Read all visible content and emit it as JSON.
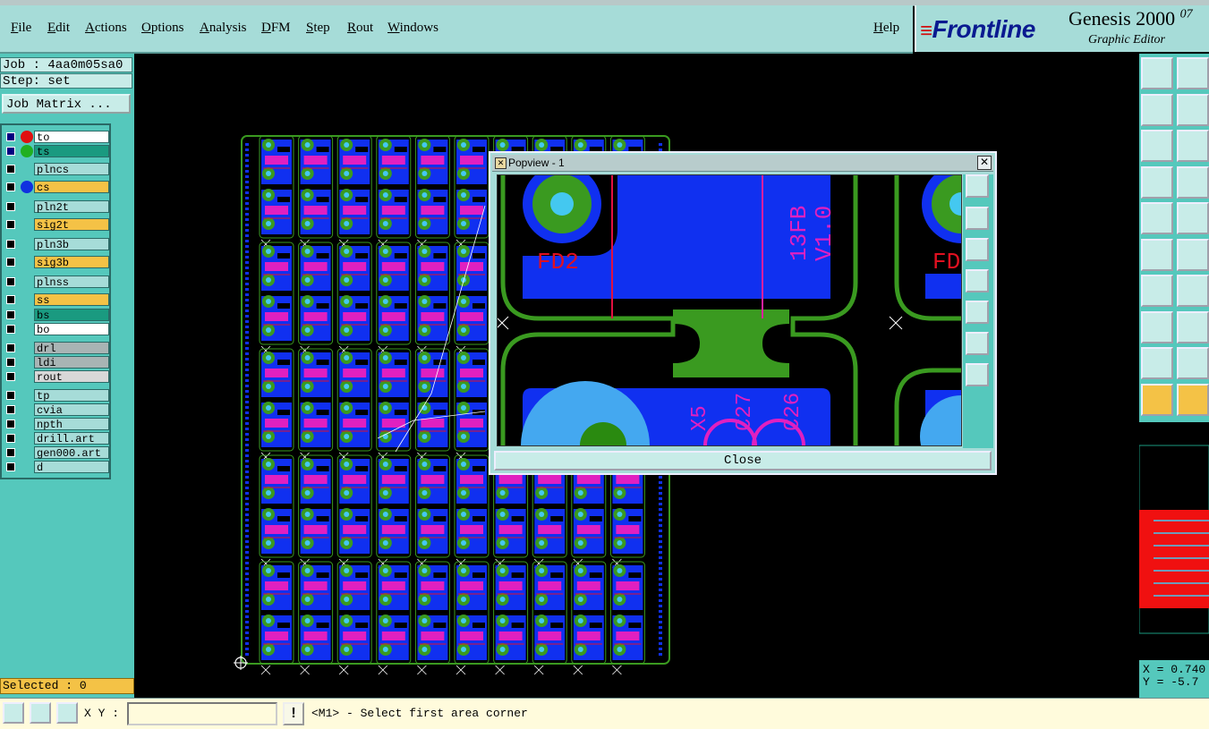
{
  "menu": {
    "items": [
      {
        "label": "File"
      },
      {
        "label": "Edit"
      },
      {
        "label": "Actions"
      },
      {
        "label": "Options"
      },
      {
        "label": "Analysis"
      },
      {
        "label": "DFM"
      },
      {
        "label": "Step"
      },
      {
        "label": "Rout"
      },
      {
        "label": "Windows"
      }
    ],
    "help": "Help"
  },
  "brand": {
    "logo": "Frontline",
    "product": "Genesis 2000",
    "version_fragment": "07",
    "subtitle": "Graphic Editor"
  },
  "job": {
    "job_line": "Job : 4aa0m05sa0",
    "step_line": "Step: set",
    "matrix_button": "Job Matrix ..."
  },
  "layers": [
    {
      "name": "to",
      "color": "#ffffff",
      "dot": "#e01010",
      "box": "#000080"
    },
    {
      "name": "ts",
      "color": "#1a9a80",
      "dot": "#20b020",
      "box": "#000080"
    },
    {
      "name": "plncs",
      "color": "#a6dcd8",
      "dot": "",
      "box": "#000000"
    },
    {
      "name": "cs",
      "color": "#f4c246",
      "dot": "#1030e0",
      "box": "#000000"
    },
    {
      "name": "pln2t",
      "color": "#a6dcd8",
      "dot": "",
      "box": "#000000"
    },
    {
      "name": "sig2t",
      "color": "#f4c246",
      "dot": "",
      "box": "#000000"
    },
    {
      "name": "pln3b",
      "color": "#a6dcd8",
      "dot": "",
      "box": "#000000"
    },
    {
      "name": "sig3b",
      "color": "#f4c246",
      "dot": "",
      "box": "#000000"
    },
    {
      "name": "plnss",
      "color": "#a6dcd8",
      "dot": "",
      "box": "#000000"
    },
    {
      "name": "ss",
      "color": "#f4c246",
      "dot": "",
      "box": "#000000"
    },
    {
      "name": "bs",
      "color": "#1a9a80",
      "dot": "",
      "box": "#000000"
    },
    {
      "name": "bo",
      "color": "#ffffff",
      "dot": "",
      "box": "#000000"
    },
    {
      "name": "drl",
      "color": "#a8b4b4",
      "dot": "",
      "box": "#000000"
    },
    {
      "name": "ldi",
      "color": "#a8b4b4",
      "dot": "",
      "box": "#000000"
    },
    {
      "name": "rout",
      "color": "#d8d8d8",
      "dot": "",
      "box": "#000000"
    },
    {
      "name": "tp",
      "color": "#a6dcd8",
      "dot": "",
      "box": "#000000"
    },
    {
      "name": "cvia",
      "color": "#a6dcd8",
      "dot": "",
      "box": "#000000"
    },
    {
      "name": "npth",
      "color": "#a6dcd8",
      "dot": "",
      "box": "#000000"
    },
    {
      "name": "drill.art",
      "color": "#a6dcd8",
      "dot": "",
      "box": "#000000"
    },
    {
      "name": "gen000.art",
      "color": "#a6dcd8",
      "dot": "",
      "box": "#000000"
    },
    {
      "name": "d",
      "color": "#a6dcd8",
      "dot": "",
      "box": "#000000"
    }
  ],
  "selected": "Selected : 0",
  "popup": {
    "title": "Popview - 1",
    "close_label": "Close",
    "labels": {
      "fd2": "FD2",
      "fd_right": "FD",
      "board_id": "13FB",
      "version": "V1.0",
      "x5": "X5",
      "c27": "C27",
      "c26": "C26"
    }
  },
  "coords": {
    "x": "X = 0.740",
    "y": "Y = -5.7"
  },
  "status": {
    "xy_label": "X Y :",
    "xy_value": "",
    "warn": "!",
    "prompt": "<M1> - Select first area corner"
  },
  "icons": [
    "zoom-home-icon",
    "move-icons",
    "snap-icon",
    "pointer-icon"
  ]
}
